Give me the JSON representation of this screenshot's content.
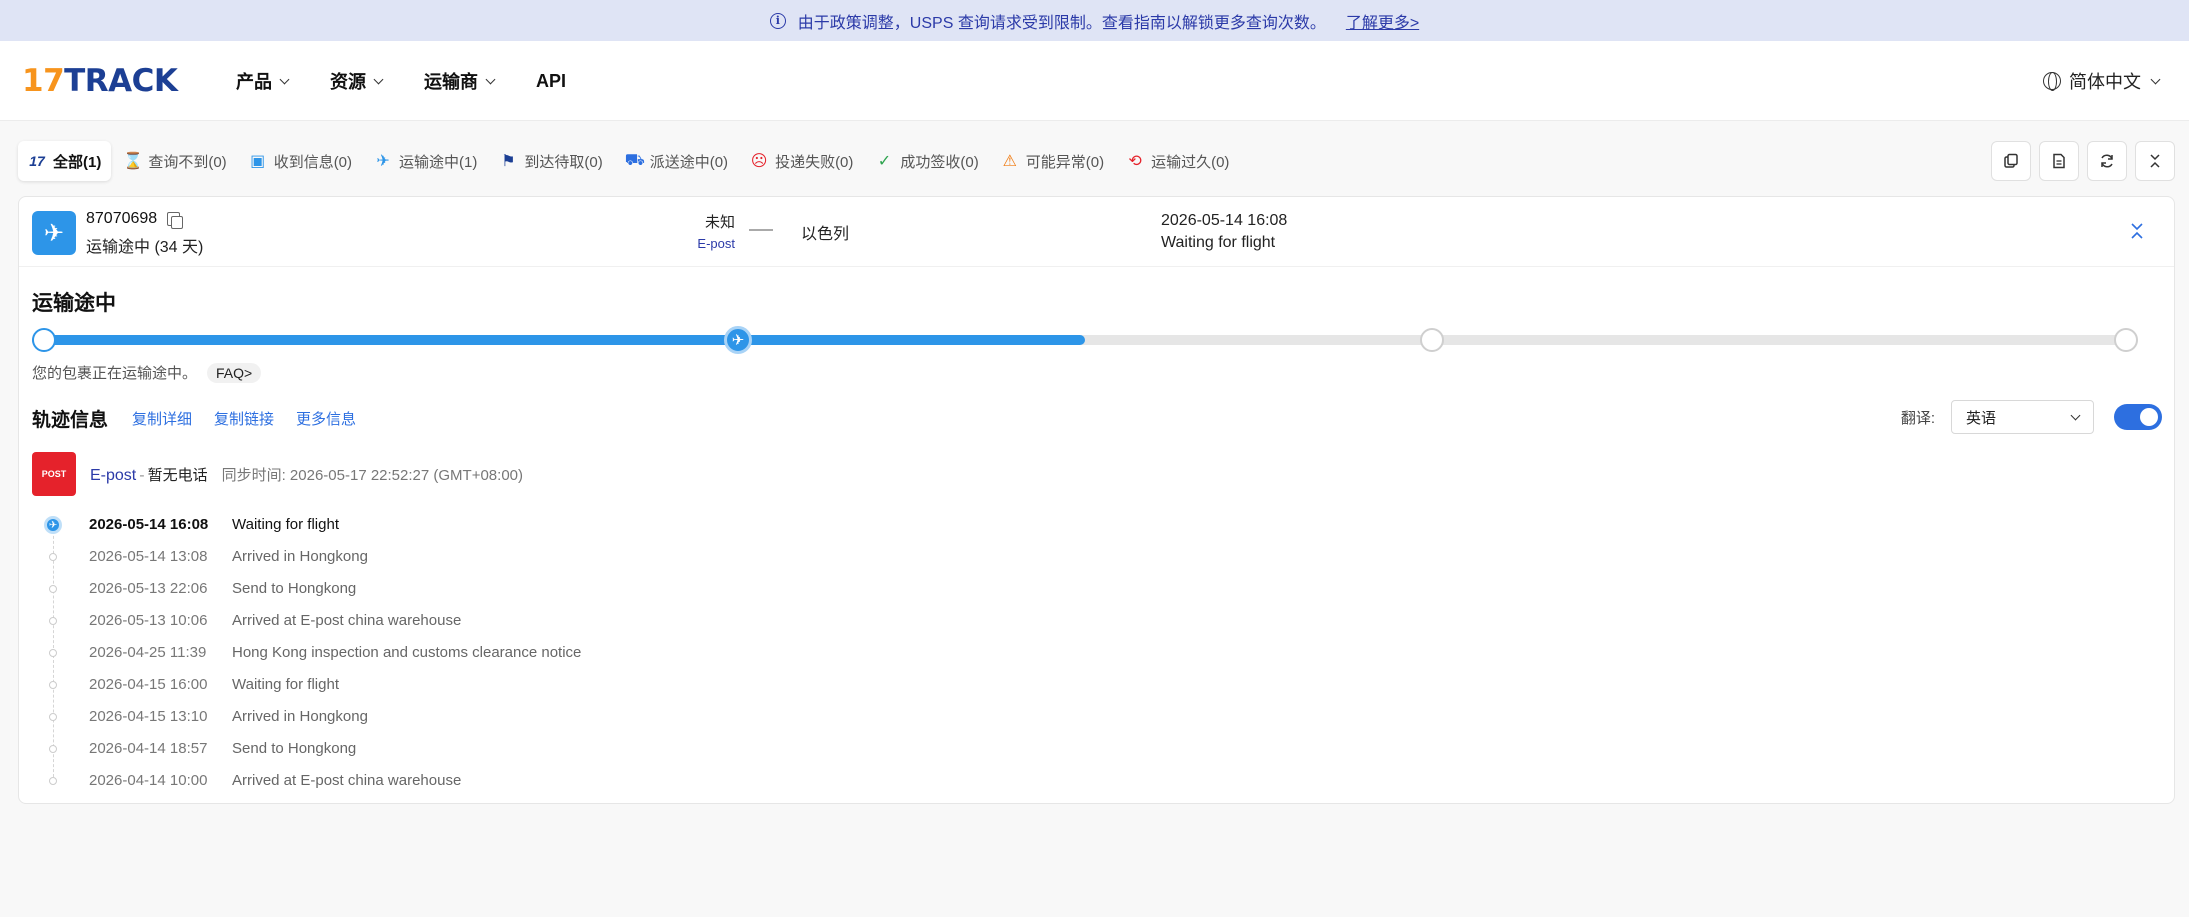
{
  "banner": {
    "text": "由于政策调整，USPS 查询请求受到限制。查看指南以解锁更多查询次数。",
    "link": "了解更多>"
  },
  "logo": {
    "num": "17",
    "word": "TRACK"
  },
  "nav": [
    {
      "label": "产品",
      "dropdown": true
    },
    {
      "label": "资源",
      "dropdown": true
    },
    {
      "label": "运输商",
      "dropdown": true
    },
    {
      "label": "API",
      "dropdown": false
    }
  ],
  "language": "简体中文",
  "filters": [
    {
      "label": "全部(1)",
      "icon": "17",
      "name": "all",
      "color": "#1c3f94"
    },
    {
      "label": "查询不到(0)",
      "icon": "⌛",
      "name": "not-found",
      "color": "#555555"
    },
    {
      "label": "收到信息(0)",
      "icon": "▣",
      "name": "info-received",
      "color": "#2d95e8"
    },
    {
      "label": "运输途中(1)",
      "icon": "✈",
      "name": "in-transit",
      "color": "#2d95e8"
    },
    {
      "label": "到达待取(0)",
      "icon": "⚑",
      "name": "pickup",
      "color": "#1c3f94"
    },
    {
      "label": "派送途中(0)",
      "icon": "⛟",
      "name": "out-for-delivery",
      "color": "#2d6fe0"
    },
    {
      "label": "投递失败(0)",
      "icon": "☹",
      "name": "failed",
      "color": "#e5222b"
    },
    {
      "label": "成功签收(0)",
      "icon": "✓",
      "name": "delivered",
      "color": "#2ea44f"
    },
    {
      "label": "可能异常(0)",
      "icon": "⚠",
      "name": "exception",
      "color": "#f07a10"
    },
    {
      "label": "运输过久(0)",
      "icon": "⟲",
      "name": "expired",
      "color": "#e5222b"
    }
  ],
  "shipment": {
    "number": "87070698",
    "status": "运输途中 (34 天)",
    "origin": "未知",
    "carrier": "E-post",
    "destination": "以色列",
    "latest_time": "2026-05-14 16:08",
    "latest_event": "Waiting for flight"
  },
  "progress": {
    "title": "运输途中",
    "fraction": 0.5,
    "current_step": 1,
    "steps": 4,
    "description": "您的包裹正在运输途中。",
    "faq": "FAQ>"
  },
  "tracking": {
    "title": "轨迹信息",
    "links": [
      "复制详细",
      "复制链接",
      "更多信息"
    ],
    "translate_label": "翻译:",
    "translate_lang": "英语",
    "carrier_logo_text": "POST",
    "carrier_name": "E-post",
    "carrier_sep": "-",
    "carrier_phone": "暂无电话",
    "sync_time": "同步时间: 2026-05-17 22:52:27 (GMT+08:00)",
    "events": [
      {
        "time": "2026-05-14 16:08",
        "desc": "Waiting for flight"
      },
      {
        "time": "2026-05-14 13:08",
        "desc": "Arrived in Hongkong"
      },
      {
        "time": "2026-05-13 22:06",
        "desc": "Send to Hongkong"
      },
      {
        "time": "2026-05-13 10:06",
        "desc": "Arrived at E-post china warehouse"
      },
      {
        "time": "2026-04-25 11:39",
        "desc": "Hong Kong inspection and customs clearance notice"
      },
      {
        "time": "2026-04-15 16:00",
        "desc": "Waiting for flight"
      },
      {
        "time": "2026-04-15 13:10",
        "desc": "Arrived in Hongkong"
      },
      {
        "time": "2026-04-14 18:57",
        "desc": "Send to Hongkong"
      },
      {
        "time": "2026-04-14 10:00",
        "desc": "Arrived at E-post china warehouse"
      }
    ]
  }
}
